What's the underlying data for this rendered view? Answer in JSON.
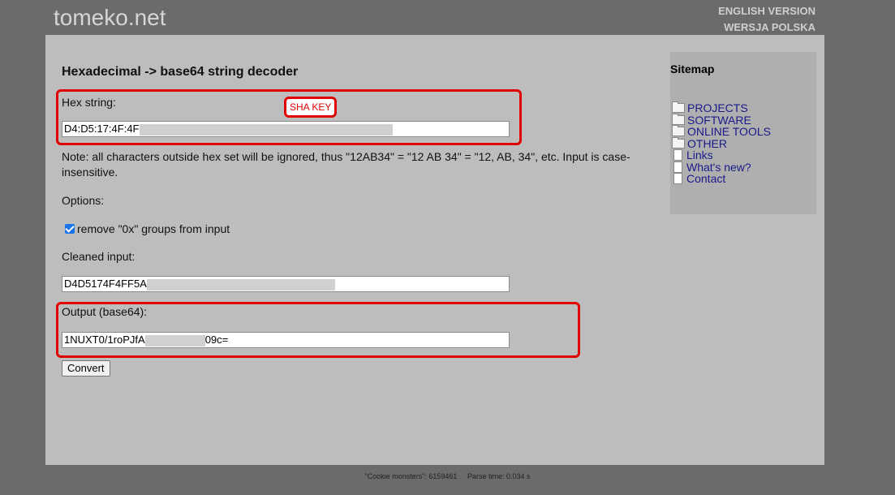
{
  "header": {
    "site_title": "tomeko.net",
    "lang_en": "ENGLISH VERSION",
    "lang_pl": "WERSJA POLSKA"
  },
  "main": {
    "title": "Hexadecimal -> base64 string decoder",
    "hex_label": "Hex string:",
    "hex_value": "D4:D5:17:4F:4F",
    "annotation": "SHA KEY",
    "note": "Note: all characters outside hex set will be ignored, thus \"12AB34\" = \"12 AB 34\" = \"12, AB, 34\", etc. Input is case-insensitive.",
    "options_label": "Options:",
    "remove_0x_label": "remove \"0x\" groups from input",
    "remove_0x_checked": true,
    "cleaned_label": "Cleaned input:",
    "cleaned_value": "D4D5174F4FF5A",
    "output_label": "Output (base64):",
    "output_value_start": "1NUXT0/1roPJfA",
    "output_value_end": "09c=",
    "convert_label": "Convert"
  },
  "sidebar": {
    "title": "Sitemap",
    "items": [
      {
        "label": "PROJECTS",
        "icon": "folder-icon"
      },
      {
        "label": "SOFTWARE",
        "icon": "folder-icon"
      },
      {
        "label": "ONLINE TOOLS",
        "icon": "folder-icon"
      },
      {
        "label": "OTHER",
        "icon": "folder-icon"
      },
      {
        "label": "Links",
        "icon": "document-icon"
      },
      {
        "label": "What's new?",
        "icon": "document-icon"
      },
      {
        "label": "Contact",
        "icon": "document-icon"
      }
    ]
  },
  "footer": {
    "cookie": "\"Cookie monsters\": 6159461",
    "parse": "Parse time: 0.034 s"
  },
  "colors": {
    "background": "#6b6b6b",
    "page": "#bdbdbd",
    "sidebar": "#afafaf",
    "annotation_red": "#e00000",
    "link": "#1a1a8a"
  }
}
